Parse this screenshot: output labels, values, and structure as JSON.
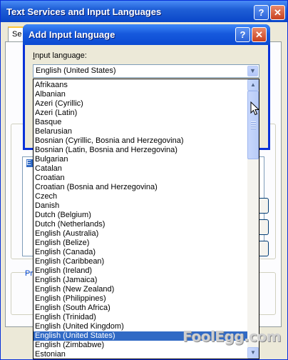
{
  "background_window": {
    "title": "Text Services and Input Languages",
    "tab_label": "Se",
    "preferences_label": "Pr",
    "selected_stub": "E"
  },
  "dialog": {
    "title": "Add Input language",
    "input_label_prefix": "I",
    "input_label_rest": "nput language:",
    "combo_value": "English (United States)"
  },
  "titlebar_buttons": {
    "help_glyph": "?",
    "close_glyph": "✕"
  },
  "dropdown": {
    "items": [
      "Afrikaans",
      "Albanian",
      "Azeri (Cyrillic)",
      "Azeri (Latin)",
      "Basque",
      "Belarusian",
      "Bosnian (Cyrillic, Bosnia and Herzegovina)",
      "Bosnian (Latin, Bosnia and Herzegovina)",
      "Bulgarian",
      "Catalan",
      "Croatian",
      "Croatian (Bosnia and Herzegovina)",
      "Czech",
      "Danish",
      "Dutch (Belgium)",
      "Dutch (Netherlands)",
      "English (Australia)",
      "English (Belize)",
      "English (Canada)",
      "English (Caribbean)",
      "English (Ireland)",
      "English (Jamaica)",
      "English (New Zealand)",
      "English (Philippines)",
      "English (South Africa)",
      "English (Trinidad)",
      "English (United Kingdom)",
      "English (United States)",
      "English (Zimbabwe)",
      "Estonian"
    ],
    "selected_item": "English (United States)",
    "scroll_up_glyph": "▲",
    "scroll_down_glyph": "▼",
    "combo_arrow_glyph": "▼"
  },
  "icons": {
    "help": "question-icon",
    "close": "close-icon",
    "cursor": "mouse-pointer-icon"
  },
  "colors": {
    "titlebar_blue": "#0a46c8",
    "selection_blue": "#316ac5",
    "close_red": "#c8401f",
    "dialog_face": "#ece9d8"
  },
  "watermark": "FoolEgg.com"
}
